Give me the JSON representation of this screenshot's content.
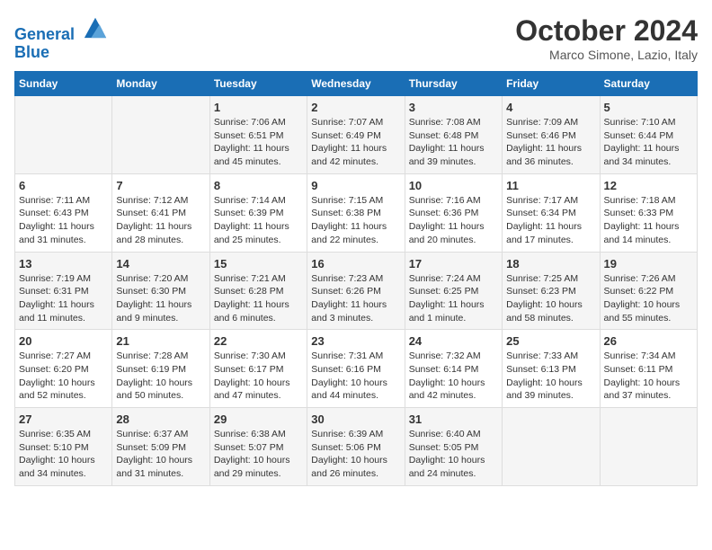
{
  "header": {
    "logo_line1": "General",
    "logo_line2": "Blue",
    "month_title": "October 2024",
    "location": "Marco Simone, Lazio, Italy"
  },
  "days_of_week": [
    "Sunday",
    "Monday",
    "Tuesday",
    "Wednesday",
    "Thursday",
    "Friday",
    "Saturday"
  ],
  "weeks": [
    [
      {
        "day": "",
        "info": ""
      },
      {
        "day": "",
        "info": ""
      },
      {
        "day": "1",
        "info": "Sunrise: 7:06 AM\nSunset: 6:51 PM\nDaylight: 11 hours and 45 minutes."
      },
      {
        "day": "2",
        "info": "Sunrise: 7:07 AM\nSunset: 6:49 PM\nDaylight: 11 hours and 42 minutes."
      },
      {
        "day": "3",
        "info": "Sunrise: 7:08 AM\nSunset: 6:48 PM\nDaylight: 11 hours and 39 minutes."
      },
      {
        "day": "4",
        "info": "Sunrise: 7:09 AM\nSunset: 6:46 PM\nDaylight: 11 hours and 36 minutes."
      },
      {
        "day": "5",
        "info": "Sunrise: 7:10 AM\nSunset: 6:44 PM\nDaylight: 11 hours and 34 minutes."
      }
    ],
    [
      {
        "day": "6",
        "info": "Sunrise: 7:11 AM\nSunset: 6:43 PM\nDaylight: 11 hours and 31 minutes."
      },
      {
        "day": "7",
        "info": "Sunrise: 7:12 AM\nSunset: 6:41 PM\nDaylight: 11 hours and 28 minutes."
      },
      {
        "day": "8",
        "info": "Sunrise: 7:14 AM\nSunset: 6:39 PM\nDaylight: 11 hours and 25 minutes."
      },
      {
        "day": "9",
        "info": "Sunrise: 7:15 AM\nSunset: 6:38 PM\nDaylight: 11 hours and 22 minutes."
      },
      {
        "day": "10",
        "info": "Sunrise: 7:16 AM\nSunset: 6:36 PM\nDaylight: 11 hours and 20 minutes."
      },
      {
        "day": "11",
        "info": "Sunrise: 7:17 AM\nSunset: 6:34 PM\nDaylight: 11 hours and 17 minutes."
      },
      {
        "day": "12",
        "info": "Sunrise: 7:18 AM\nSunset: 6:33 PM\nDaylight: 11 hours and 14 minutes."
      }
    ],
    [
      {
        "day": "13",
        "info": "Sunrise: 7:19 AM\nSunset: 6:31 PM\nDaylight: 11 hours and 11 minutes."
      },
      {
        "day": "14",
        "info": "Sunrise: 7:20 AM\nSunset: 6:30 PM\nDaylight: 11 hours and 9 minutes."
      },
      {
        "day": "15",
        "info": "Sunrise: 7:21 AM\nSunset: 6:28 PM\nDaylight: 11 hours and 6 minutes."
      },
      {
        "day": "16",
        "info": "Sunrise: 7:23 AM\nSunset: 6:26 PM\nDaylight: 11 hours and 3 minutes."
      },
      {
        "day": "17",
        "info": "Sunrise: 7:24 AM\nSunset: 6:25 PM\nDaylight: 11 hours and 1 minute."
      },
      {
        "day": "18",
        "info": "Sunrise: 7:25 AM\nSunset: 6:23 PM\nDaylight: 10 hours and 58 minutes."
      },
      {
        "day": "19",
        "info": "Sunrise: 7:26 AM\nSunset: 6:22 PM\nDaylight: 10 hours and 55 minutes."
      }
    ],
    [
      {
        "day": "20",
        "info": "Sunrise: 7:27 AM\nSunset: 6:20 PM\nDaylight: 10 hours and 52 minutes."
      },
      {
        "day": "21",
        "info": "Sunrise: 7:28 AM\nSunset: 6:19 PM\nDaylight: 10 hours and 50 minutes."
      },
      {
        "day": "22",
        "info": "Sunrise: 7:30 AM\nSunset: 6:17 PM\nDaylight: 10 hours and 47 minutes."
      },
      {
        "day": "23",
        "info": "Sunrise: 7:31 AM\nSunset: 6:16 PM\nDaylight: 10 hours and 44 minutes."
      },
      {
        "day": "24",
        "info": "Sunrise: 7:32 AM\nSunset: 6:14 PM\nDaylight: 10 hours and 42 minutes."
      },
      {
        "day": "25",
        "info": "Sunrise: 7:33 AM\nSunset: 6:13 PM\nDaylight: 10 hours and 39 minutes."
      },
      {
        "day": "26",
        "info": "Sunrise: 7:34 AM\nSunset: 6:11 PM\nDaylight: 10 hours and 37 minutes."
      }
    ],
    [
      {
        "day": "27",
        "info": "Sunrise: 6:35 AM\nSunset: 5:10 PM\nDaylight: 10 hours and 34 minutes."
      },
      {
        "day": "28",
        "info": "Sunrise: 6:37 AM\nSunset: 5:09 PM\nDaylight: 10 hours and 31 minutes."
      },
      {
        "day": "29",
        "info": "Sunrise: 6:38 AM\nSunset: 5:07 PM\nDaylight: 10 hours and 29 minutes."
      },
      {
        "day": "30",
        "info": "Sunrise: 6:39 AM\nSunset: 5:06 PM\nDaylight: 10 hours and 26 minutes."
      },
      {
        "day": "31",
        "info": "Sunrise: 6:40 AM\nSunset: 5:05 PM\nDaylight: 10 hours and 24 minutes."
      },
      {
        "day": "",
        "info": ""
      },
      {
        "day": "",
        "info": ""
      }
    ]
  ]
}
